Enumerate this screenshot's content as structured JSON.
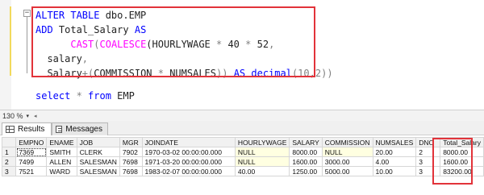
{
  "editor": {
    "fold_glyph": "−",
    "lines": {
      "l1_kw": "ALTER TABLE",
      "l1_rest": " dbo.EMP",
      "l2_kw": "ADD",
      "l2_name": " Total_Salary ",
      "l2_as": "AS",
      "l3_indent": "      ",
      "l3_cast": "CAST",
      "l3_paren1": "(",
      "l3_coalesce": "COALESCE",
      "l3_rest1": "(HOURLYWAGE ",
      "l3_mul1": "*",
      "l3_rest2": " 40 ",
      "l3_mul2": "*",
      "l3_rest3": " 52",
      "l3_comma": ",",
      "l4_text": "  salary",
      "l4_comma": ",",
      "l5_text": "  Salary",
      "l5_plus": "+",
      "l5_paren": "(",
      "l5_rest1": "COMMISSION ",
      "l5_mul": "*",
      "l5_rest2": " NUMSALES",
      "l5_close": "))",
      "l5_as": " AS ",
      "l5_type": "decimal",
      "l5_args": "(10",
      "l5_comma": ",",
      "l5_end": "2))",
      "l6_select": "select",
      "l6_star": " * ",
      "l6_from": "from",
      "l6_rest": " EMP"
    }
  },
  "zoom": {
    "value": "130 %",
    "arrow": "▾",
    "scroll": "◂"
  },
  "tabs": {
    "results": "Results",
    "messages": "Messages"
  },
  "grid": {
    "columns": [
      "",
      "EMPNO",
      "ENAME",
      "JOB",
      "MGR",
      "JOINDATE",
      "HOURLYWAGE",
      "SALARY",
      "COMMISSION",
      "NUMSALES",
      "DNO",
      "Total_Salary"
    ],
    "rows": [
      [
        "1",
        "7369",
        "SMITH",
        "CLERK",
        "7902",
        "1970-03-02 00:00:00.000",
        "NULL",
        "8000.00",
        "NULL",
        "20.00",
        "2",
        "8000.00"
      ],
      [
        "2",
        "7499",
        "ALLEN",
        "SALESMAN",
        "7698",
        "1971-03-20 00:00:00.000",
        "NULL",
        "1600.00",
        "3000.00",
        "4.00",
        "3",
        "1600.00"
      ],
      [
        "3",
        "7521",
        "WARD",
        "SALESMAN",
        "7698",
        "1983-02-07 00:00:00.000",
        "40.00",
        "1250.00",
        "5000.00",
        "10.00",
        "3",
        "83200.00"
      ]
    ]
  },
  "colors": {
    "keyword": "#0000ff",
    "function": "#ff00ff",
    "operator": "#808080",
    "highlight": "#e2333a",
    "null_bg": "#ffffe1"
  }
}
